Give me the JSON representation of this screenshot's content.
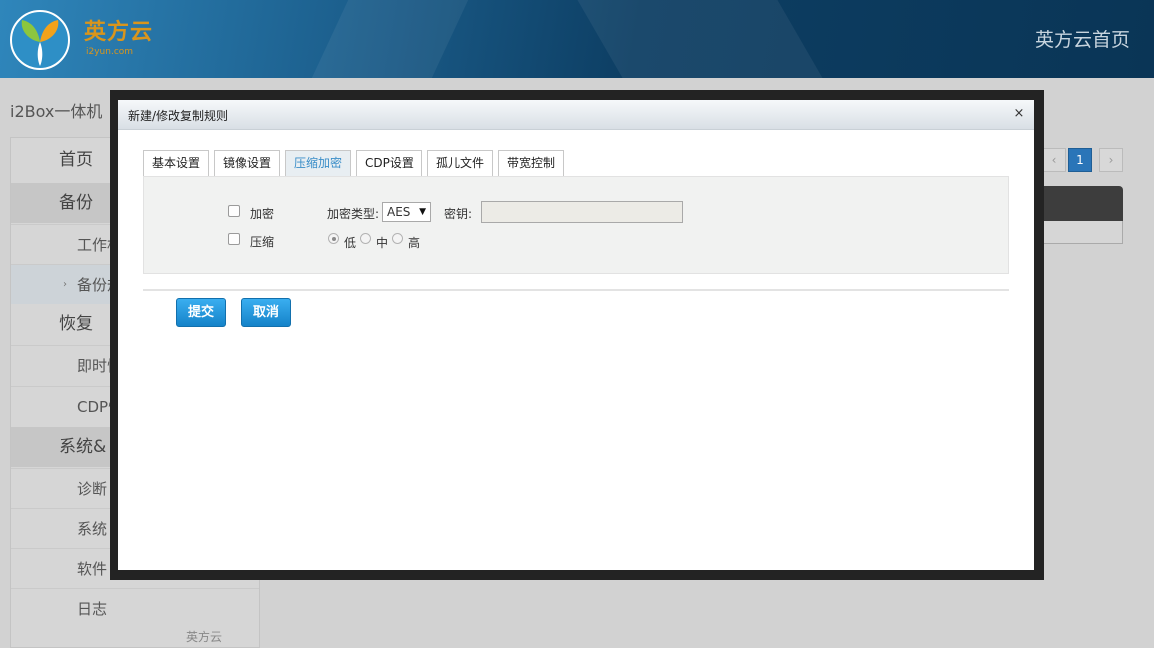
{
  "header": {
    "logo_text": "英方云",
    "logo_subtext": "i2yun.com",
    "home_link": "英方云首页"
  },
  "breadcrumb": "i2Box一体机",
  "sidebar": {
    "items": [
      {
        "label": "首页",
        "level": "main"
      },
      {
        "label": "备份",
        "level": "main"
      },
      {
        "label": "工作机",
        "level": "sub"
      },
      {
        "label": "备份规",
        "level": "sub"
      },
      {
        "label": "恢复",
        "level": "main"
      },
      {
        "label": "即时恢",
        "level": "sub"
      },
      {
        "label": "CDP恢",
        "level": "sub"
      },
      {
        "label": "系统&",
        "level": "main"
      },
      {
        "label": "诊断",
        "level": "sub"
      },
      {
        "label": "系统",
        "level": "sub"
      },
      {
        "label": "软件",
        "level": "sub"
      },
      {
        "label": "日志",
        "level": "sub"
      }
    ],
    "footer": "英方云"
  },
  "pagination": {
    "prev": "‹",
    "current": "1",
    "next": "›"
  },
  "modal": {
    "title": "新建/修改复制规则",
    "close": "×",
    "tabs": [
      {
        "label": "基本设置",
        "active": false
      },
      {
        "label": "镜像设置",
        "active": false
      },
      {
        "label": "压缩加密",
        "active": true
      },
      {
        "label": "CDP设置",
        "active": false
      },
      {
        "label": "孤儿文件",
        "active": false
      },
      {
        "label": "带宽控制",
        "active": false
      }
    ],
    "form": {
      "encrypt_label": "加密",
      "encrypt_type_label": "加密类型:",
      "encrypt_type_value": "AES",
      "key_label": "密钥:",
      "key_value": "",
      "compress_label": "压缩",
      "compress_levels": [
        "低",
        "中",
        "高"
      ],
      "compress_selected": "低"
    },
    "buttons": {
      "submit": "提交",
      "cancel": "取消"
    }
  },
  "colors": {
    "accent": "#1f93dc",
    "header_bg": "#1c5f8d",
    "active_tab_text": "#3a8ec8"
  }
}
